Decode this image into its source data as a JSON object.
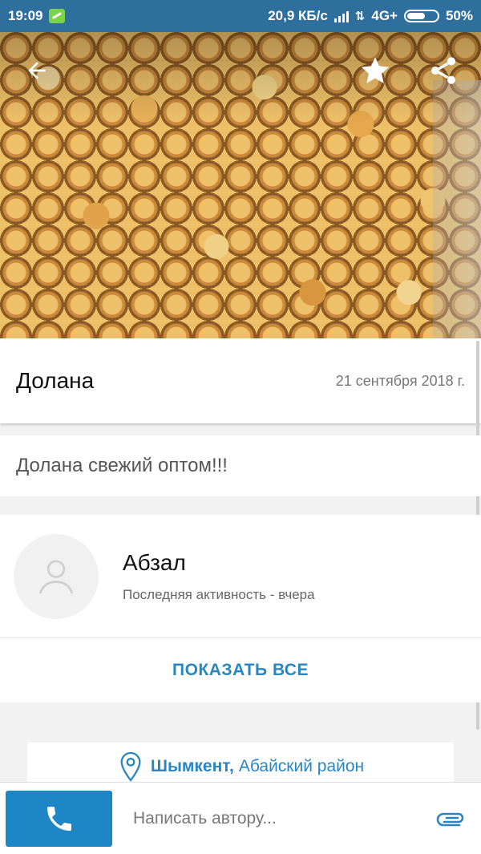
{
  "status_bar": {
    "time": "19:09",
    "speed": "20,9 КБ/с",
    "network": "4G+",
    "battery": "50%"
  },
  "listing": {
    "title": "Долана",
    "date": "21 сентября 2018 г.",
    "description": "Долана свежий оптом!!!"
  },
  "author": {
    "name": "Абзал",
    "activity": "Последняя активность - вчера",
    "show_all_label": "ПОКАЗАТЬ ВСЕ"
  },
  "location": {
    "city": "Шымкент,",
    "district": "Абайский район"
  },
  "bottom_bar": {
    "message_placeholder": "Написать автору..."
  },
  "icons": {
    "back": "back-arrow-icon",
    "favorite": "star-icon",
    "share": "share-icon",
    "avatar": "user-placeholder-icon",
    "location": "location-pin-icon",
    "call": "phone-icon",
    "attach": "paperclip-icon"
  },
  "colors": {
    "status_bar": "#2f6f9e",
    "accent": "#2a86c1",
    "call_button": "#1f86c6"
  }
}
